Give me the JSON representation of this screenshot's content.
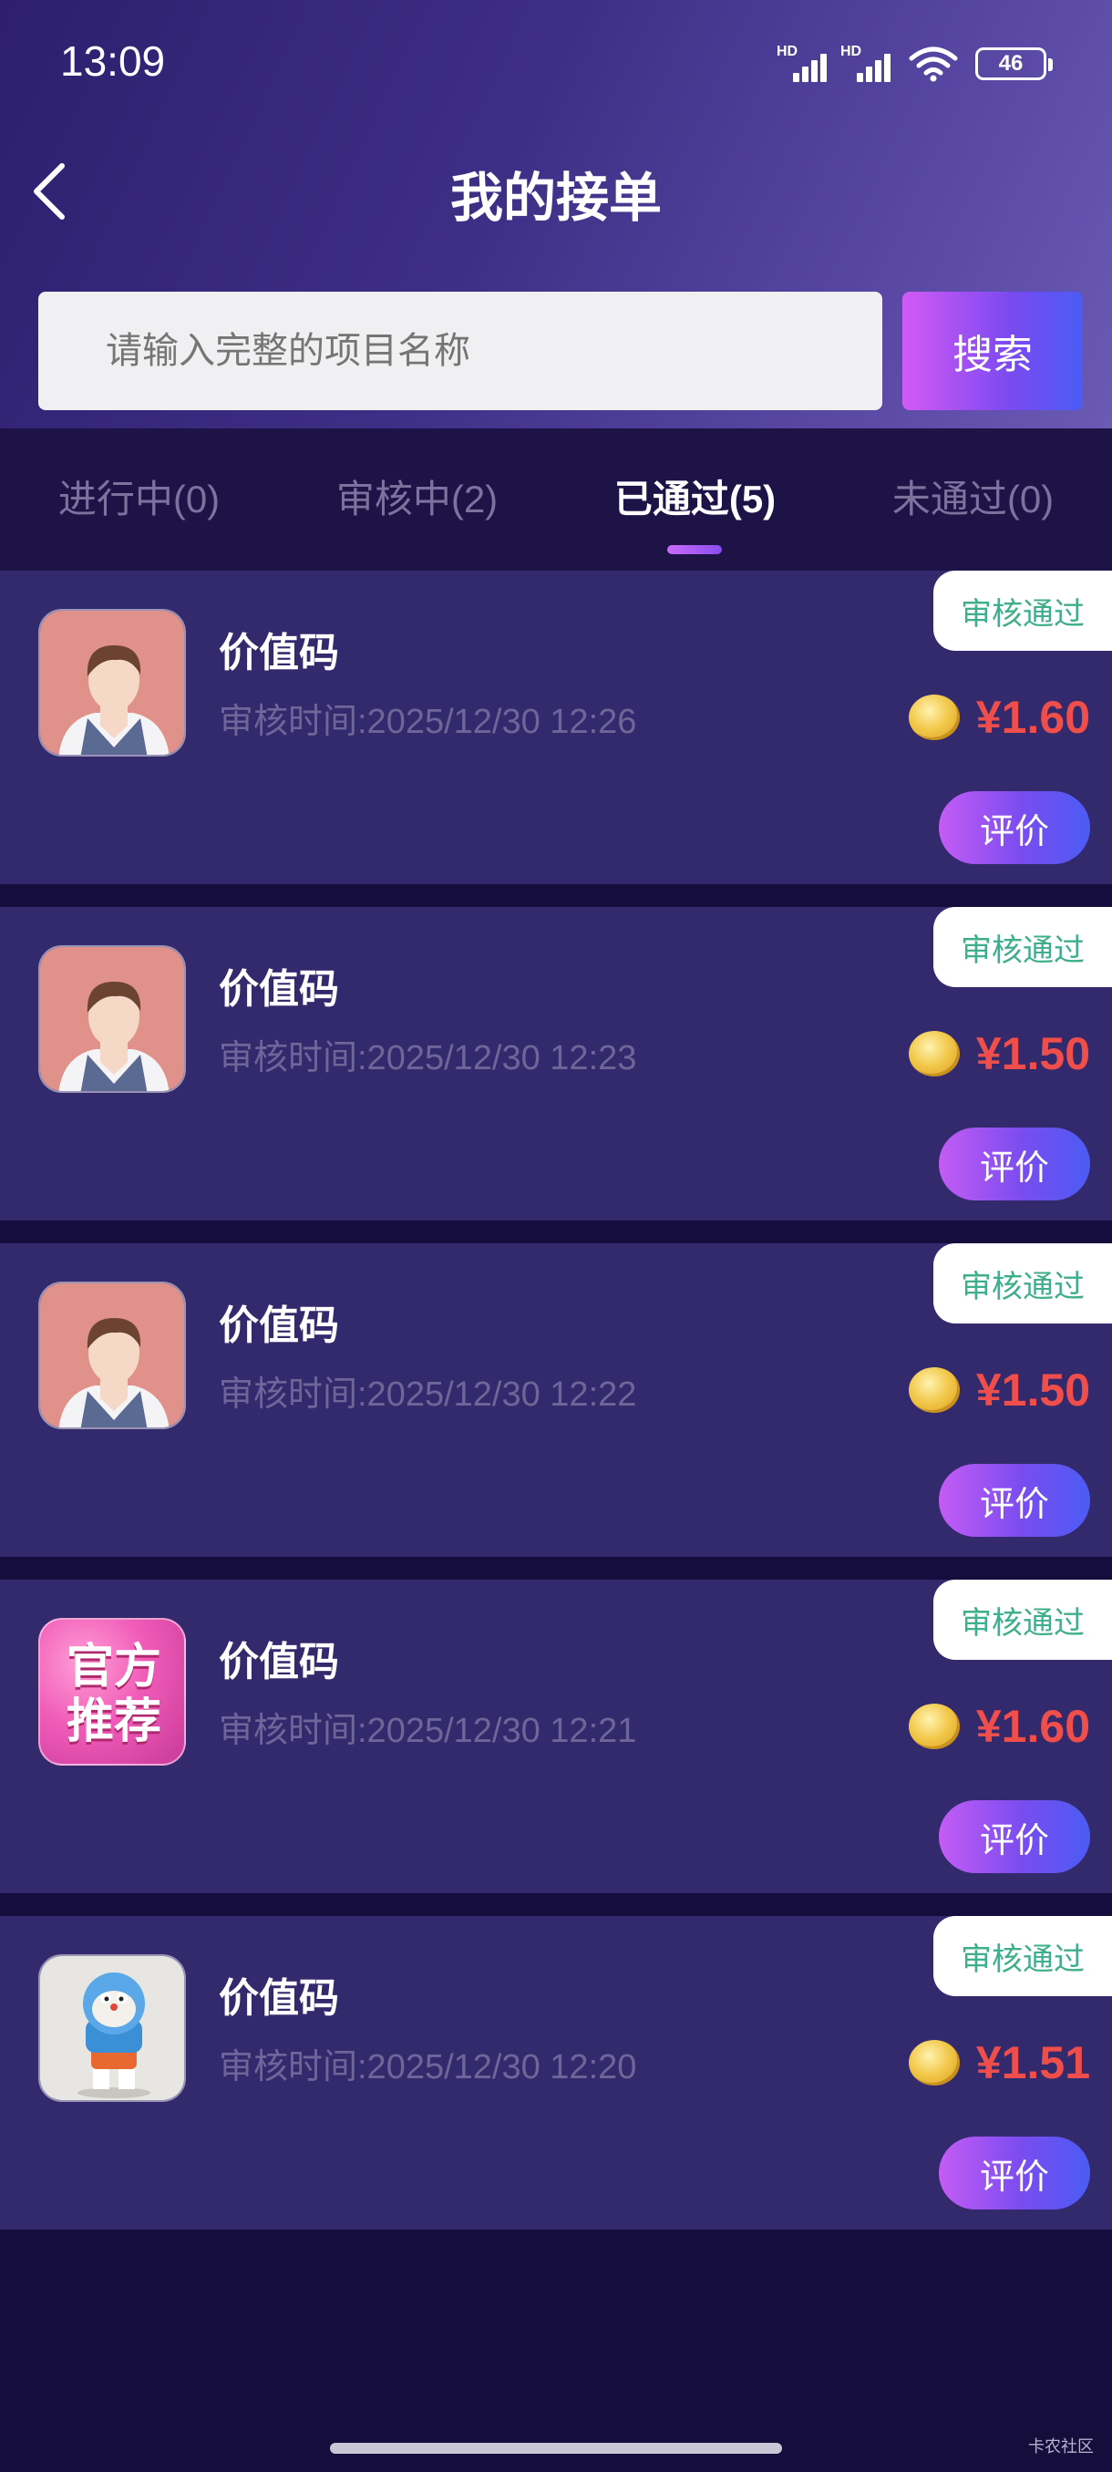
{
  "status_bar": {
    "time": "13:09",
    "signal_1_label": "HD",
    "signal_2_label": "HD",
    "battery": "46"
  },
  "header": {
    "title": "我的接单",
    "back_icon": "chevron-left-icon"
  },
  "search": {
    "placeholder": "请输入完整的项目名称",
    "button_label": "搜索"
  },
  "tabs": [
    {
      "label": "进行中(0)",
      "active": false
    },
    {
      "label": "审核中(2)",
      "active": false
    },
    {
      "label": "已通过(5)",
      "active": true
    },
    {
      "label": "未通过(0)",
      "active": false
    }
  ],
  "items": [
    {
      "title": "价值码",
      "time": "审核时间:2025/12/30 12:26",
      "status": "审核通过",
      "price": "¥1.60",
      "action": "评价",
      "avatar": "person-avatar"
    },
    {
      "title": "价值码",
      "time": "审核时间:2025/12/30 12:23",
      "status": "审核通过",
      "price": "¥1.50",
      "action": "评价",
      "avatar": "person-avatar"
    },
    {
      "title": "价值码",
      "time": "审核时间:2025/12/30 12:22",
      "status": "审核通过",
      "price": "¥1.50",
      "action": "评价",
      "avatar": "person-avatar"
    },
    {
      "title": "价值码",
      "time": "审核时间:2025/12/30 12:21",
      "status": "审核通过",
      "price": "¥1.60",
      "action": "评价",
      "avatar": "official-recommend-avatar",
      "avatar_text": [
        "官方",
        "推荐"
      ]
    },
    {
      "title": "价值码",
      "time": "审核时间:2025/12/30 12:20",
      "status": "审核通过",
      "price": "¥1.51",
      "action": "评价",
      "avatar": "doraemon-figure-avatar"
    }
  ],
  "watermark": "卡农社区",
  "colors": {
    "header_bg": "#3e2f86",
    "page_bg": "#150e3c",
    "card_bg": "#33296d",
    "status_green": "#3fae8a",
    "price_red": "#f04e4b"
  }
}
